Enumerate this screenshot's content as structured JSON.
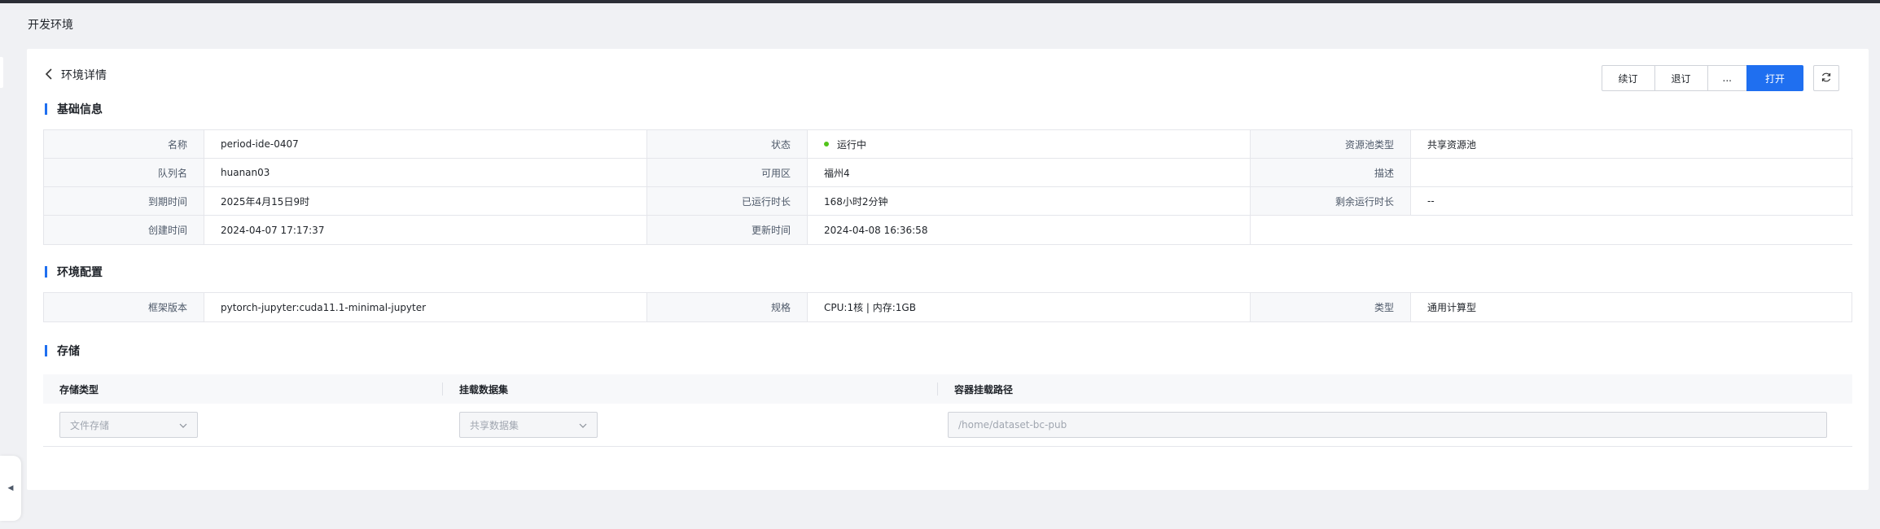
{
  "page": {
    "title": "开发环境"
  },
  "header": {
    "back_title": "环境详情"
  },
  "actions": {
    "renew": "续订",
    "unsubscribe": "退订",
    "more": "...",
    "open": "打开"
  },
  "basic": {
    "section_title": "基础信息",
    "rows": [
      [
        {
          "label": "名称",
          "value": "period-ide-0407"
        },
        {
          "label": "状态",
          "value": "运行中"
        },
        {
          "label": "资源池类型",
          "value": "共享资源池"
        }
      ],
      [
        {
          "label": "队列名",
          "value": "huanan03"
        },
        {
          "label": "可用区",
          "value": "福州4"
        },
        {
          "label": "描述",
          "value": ""
        }
      ],
      [
        {
          "label": "到期时间",
          "value": "2025年4月15日9时"
        },
        {
          "label": "已运行时长",
          "value": "168小时2分钟"
        },
        {
          "label": "剩余运行时长",
          "value": "--"
        }
      ],
      [
        {
          "label": "创建时间",
          "value": "2024-04-07 17:17:37"
        },
        {
          "label": "更新时间",
          "value": "2024-04-08 16:36:58"
        }
      ]
    ],
    "status_color": "#52c41a"
  },
  "config": {
    "section_title": "环境配置",
    "rows": [
      [
        {
          "label": "框架版本",
          "value": "pytorch-jupyter:cuda11.1-minimal-jupyter"
        },
        {
          "label": "规格",
          "value": "CPU:1核 | 内存:1GB"
        },
        {
          "label": "类型",
          "value": "通用计算型"
        }
      ]
    ]
  },
  "storage": {
    "section_title": "存储",
    "columns": [
      "存储类型",
      "挂载数据集",
      "容器挂载路径"
    ],
    "row": {
      "type_placeholder": "文件存储",
      "dataset_placeholder": "共享数据集",
      "path_placeholder": "/home/dataset-bc-pub"
    }
  },
  "colors": {
    "accent": "#1f6ff0",
    "sidebar": "#2b2e36"
  }
}
